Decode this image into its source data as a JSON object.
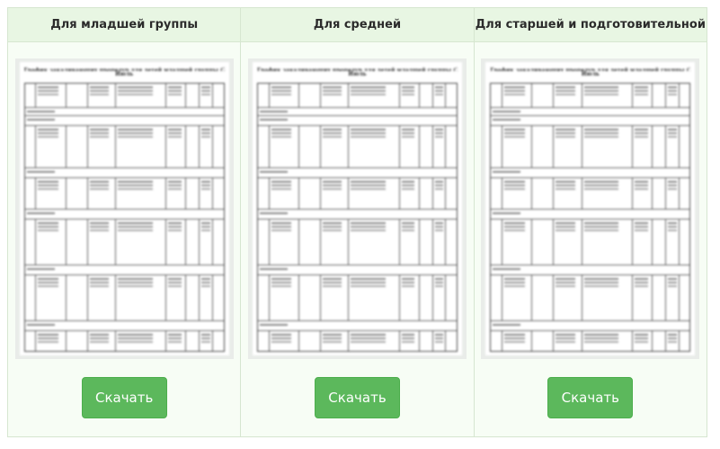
{
  "cards": [
    {
      "title": "Для младшей группы",
      "button": "Скачать",
      "doc_title": "График закаливающих процедур для детей младшей группы (2–3 лет)",
      "doc_subtitle": "Июль"
    },
    {
      "title": "Для средней",
      "button": "Скачать",
      "doc_title": "График закаливающих процедур для детей младшей группы (2–3 лет)",
      "doc_subtitle": "Июль"
    },
    {
      "title": "Для старшей и подготовительной",
      "button": "Скачать",
      "doc_title": "График закаливающих процедур для детей младшей группы (2–3 лет)",
      "doc_subtitle": "Июль"
    }
  ],
  "colors": {
    "button_green": "#5cb85c",
    "header_bg": "#e8f6e3",
    "border": "#d6e6d0"
  }
}
